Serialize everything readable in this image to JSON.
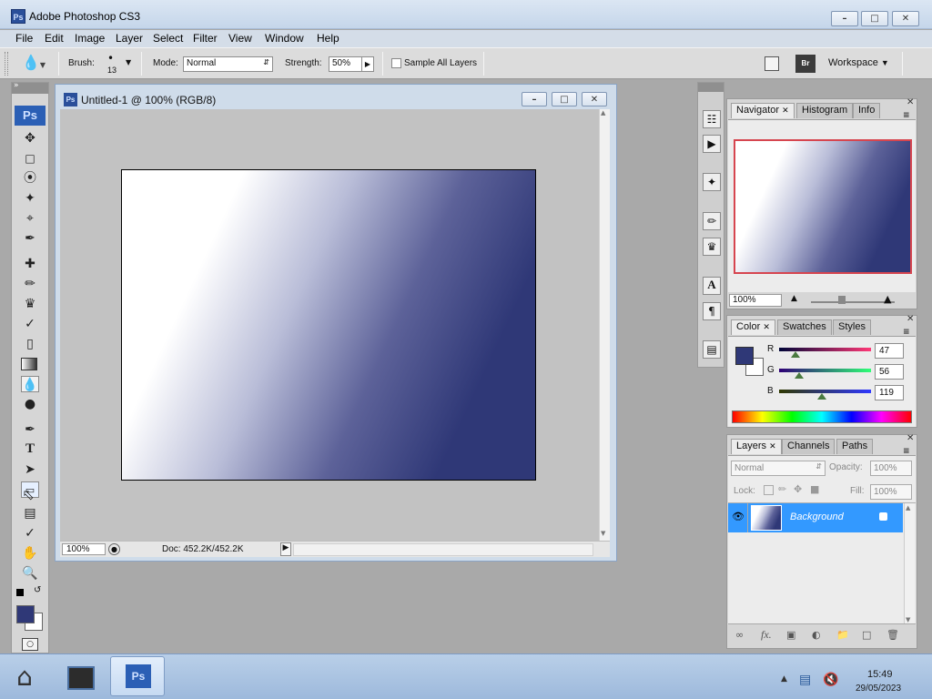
{
  "window": {
    "title": "Adobe Photoshop CS3",
    "app_icon": "Ps"
  },
  "menu": [
    "File",
    "Edit",
    "Image",
    "Layer",
    "Select",
    "Filter",
    "View",
    "Window",
    "Help"
  ],
  "options": {
    "brush_label": "Brush:",
    "brush_size": "13",
    "mode_label": "Mode:",
    "mode_value": "Normal",
    "strength_label": "Strength:",
    "strength_value": "50%",
    "sample_label": "Sample All Layers",
    "workspace_label": "Workspace"
  },
  "toolbox": {
    "logo": "Ps",
    "foreground_color": "#2f3877",
    "background_color": "#ffffff"
  },
  "document": {
    "title": "Untitled-1 @ 100% (RGB/8)",
    "zoom": "100%",
    "doc_info": "Doc: 452.2K/452.2K",
    "gradient_start": "#ffffff",
    "gradient_end": "#2f3877"
  },
  "navigator": {
    "tabs": [
      "Navigator",
      "Histogram",
      "Info"
    ],
    "zoom": "100%"
  },
  "color_panel": {
    "tabs": [
      "Color",
      "Swatches",
      "Styles"
    ],
    "r_label": "R",
    "g_label": "G",
    "b_label": "B",
    "r": "47",
    "g": "56",
    "b": "119",
    "r_fraction": 0.18,
    "g_fraction": 0.22,
    "b_fraction": 0.47
  },
  "layers_panel": {
    "tabs": [
      "Layers",
      "Channels",
      "Paths"
    ],
    "blend_mode": "Normal",
    "opacity_label": "Opacity:",
    "opacity": "100%",
    "lock_label": "Lock:",
    "fill_label": "Fill:",
    "fill": "100%",
    "layer_name": "Background"
  },
  "taskbar": {
    "active_app": "Ps",
    "time": "15:49",
    "date": "29/05/2023"
  }
}
